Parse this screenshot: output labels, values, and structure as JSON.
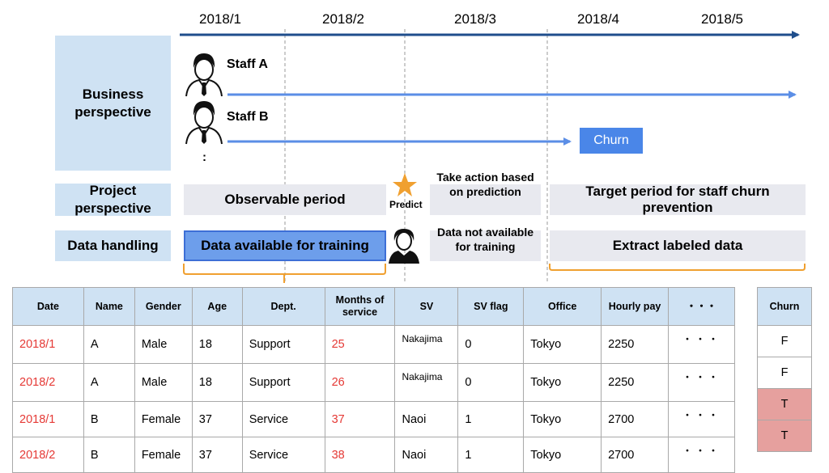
{
  "timeline": {
    "months": [
      "2018/1",
      "2018/2",
      "2018/3",
      "2018/4",
      "2018/5"
    ],
    "arrow_color": "#1f4e8c"
  },
  "rows": {
    "business": "Business perspective",
    "project": "Project perspective",
    "data_handling": "Data handling"
  },
  "staff": {
    "a": "Staff A",
    "b": "Staff B",
    "more": ":"
  },
  "churn_tag": "Churn",
  "project_boxes": {
    "observable": "Observable period",
    "predict": "Predict",
    "take_action": "Take action based on prediction",
    "target": "Target period for staff churn prevention"
  },
  "data_boxes": {
    "available": "Data available for training",
    "not_available": "Data not available for training",
    "extract": "Extract labeled data"
  },
  "table": {
    "headers": [
      "Date",
      "Name",
      "Gender",
      "Age",
      "Dept.",
      "Months of service",
      "SV",
      "SV flag",
      "Office",
      "Hourly pay",
      "・・・"
    ],
    "rows": [
      [
        "2018/1",
        "A",
        "Male",
        "18",
        "Support",
        "25",
        "Nakajima",
        "0",
        "Tokyo",
        "2250",
        "・・・"
      ],
      [
        "2018/2",
        "A",
        "Male",
        "18",
        "Support",
        "26",
        "Nakajima",
        "0",
        "Tokyo",
        "2250",
        "・・・"
      ],
      [
        "2018/1",
        "B",
        "Female",
        "37",
        "Service",
        "37",
        "Naoi",
        "1",
        "Tokyo",
        "2700",
        "・・・"
      ],
      [
        "2018/2",
        "B",
        "Female",
        "37",
        "Service",
        "38",
        "Naoi",
        "1",
        "Tokyo",
        "2700",
        "・・・"
      ]
    ]
  },
  "churn_table": {
    "header": "Churn",
    "values": [
      "F",
      "F",
      "T",
      "T"
    ]
  },
  "colors": {
    "label_bg": "#cfe2f3",
    "gray_bg": "#e8e9ef",
    "highlight": "#6d9eeb",
    "bracket": "#f0a030",
    "red_text": "#e53935",
    "churn_true": "#e6a09e"
  }
}
